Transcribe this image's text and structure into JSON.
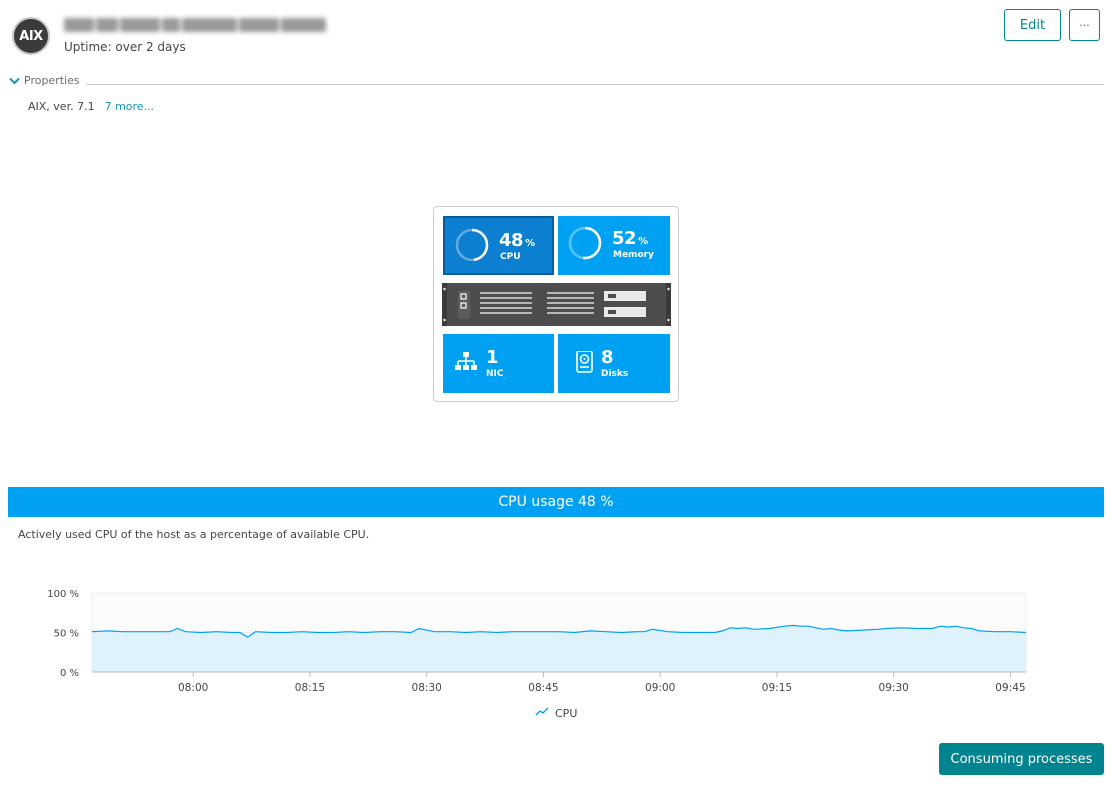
{
  "header": {
    "os_badge": "AIX",
    "host_name": "",
    "uptime": "Uptime: over 2 days",
    "edit_label": "Edit",
    "more_label": "···"
  },
  "properties": {
    "toggle_label": "Properties",
    "os_version": "AIX, ver. 7.1",
    "more_link": "7 more..."
  },
  "host_tile": {
    "cpu": {
      "value": "48",
      "unit": "%",
      "label": "CPU",
      "percent": 48
    },
    "memory": {
      "value": "52",
      "unit": "%",
      "label": "Memory",
      "percent": 52
    },
    "nic": {
      "value": "1",
      "label": "NIC"
    },
    "disks": {
      "value": "8",
      "label": "Disks"
    }
  },
  "cpu_section": {
    "banner": "CPU usage 48 %",
    "description": "Actively used CPU of the host as a percentage of available CPU."
  },
  "chart_data": {
    "type": "area",
    "title": "",
    "xlabel": "",
    "ylabel": "",
    "ylim": [
      0,
      100
    ],
    "y_ticks": [
      "100 %",
      "50 %",
      "0 %"
    ],
    "x_ticks": [
      "08:00",
      "08:15",
      "08:30",
      "08:45",
      "09:00",
      "09:15",
      "09:30",
      "09:45"
    ],
    "x_range": [
      "07:47",
      "09:47"
    ],
    "grid": true,
    "legend": "bottom-center",
    "color": "#00a1f2",
    "series": [
      {
        "name": "CPU",
        "x": [
          "07:47",
          "07:49",
          "07:51",
          "07:53",
          "07:55",
          "07:57",
          "07:58",
          "07:59",
          "08:01",
          "08:03",
          "08:05",
          "08:06",
          "08:07",
          "08:08",
          "08:10",
          "08:12",
          "08:14",
          "08:16",
          "08:18",
          "08:20",
          "08:22",
          "08:24",
          "08:26",
          "08:28",
          "08:29",
          "08:31",
          "08:33",
          "08:35",
          "08:37",
          "08:39",
          "08:41",
          "08:43",
          "08:45",
          "08:47",
          "08:49",
          "08:51",
          "08:53",
          "08:55",
          "08:57",
          "08:58",
          "08:59",
          "09:01",
          "09:03",
          "09:05",
          "09:07",
          "09:08",
          "09:09",
          "09:10",
          "09:11",
          "09:12",
          "09:14",
          "09:16",
          "09:17",
          "09:18",
          "09:19",
          "09:20",
          "09:21",
          "09:22",
          "09:23",
          "09:24",
          "09:26",
          "09:28",
          "09:29",
          "09:31",
          "09:33",
          "09:35",
          "09:36",
          "09:37",
          "09:38",
          "09:39",
          "09:40",
          "09:41",
          "09:43",
          "09:45",
          "09:47"
        ],
        "values": [
          51,
          52,
          51,
          51,
          51,
          51,
          55,
          51,
          50,
          51,
          50,
          50,
          44,
          51,
          50,
          50,
          51,
          50,
          50,
          51,
          50,
          51,
          51,
          50,
          55,
          51,
          51,
          50,
          51,
          50,
          51,
          51,
          51,
          51,
          50,
          52,
          51,
          50,
          51,
          51,
          54,
          51,
          50,
          50,
          50,
          52,
          56,
          55,
          56,
          54,
          55,
          58,
          59,
          58,
          58,
          56,
          54,
          55,
          53,
          52,
          53,
          54,
          55,
          56,
          55,
          55,
          58,
          57,
          58,
          56,
          55,
          52,
          51,
          51,
          50
        ]
      }
    ]
  },
  "actions": {
    "consuming_processes": "Consuming processes"
  }
}
